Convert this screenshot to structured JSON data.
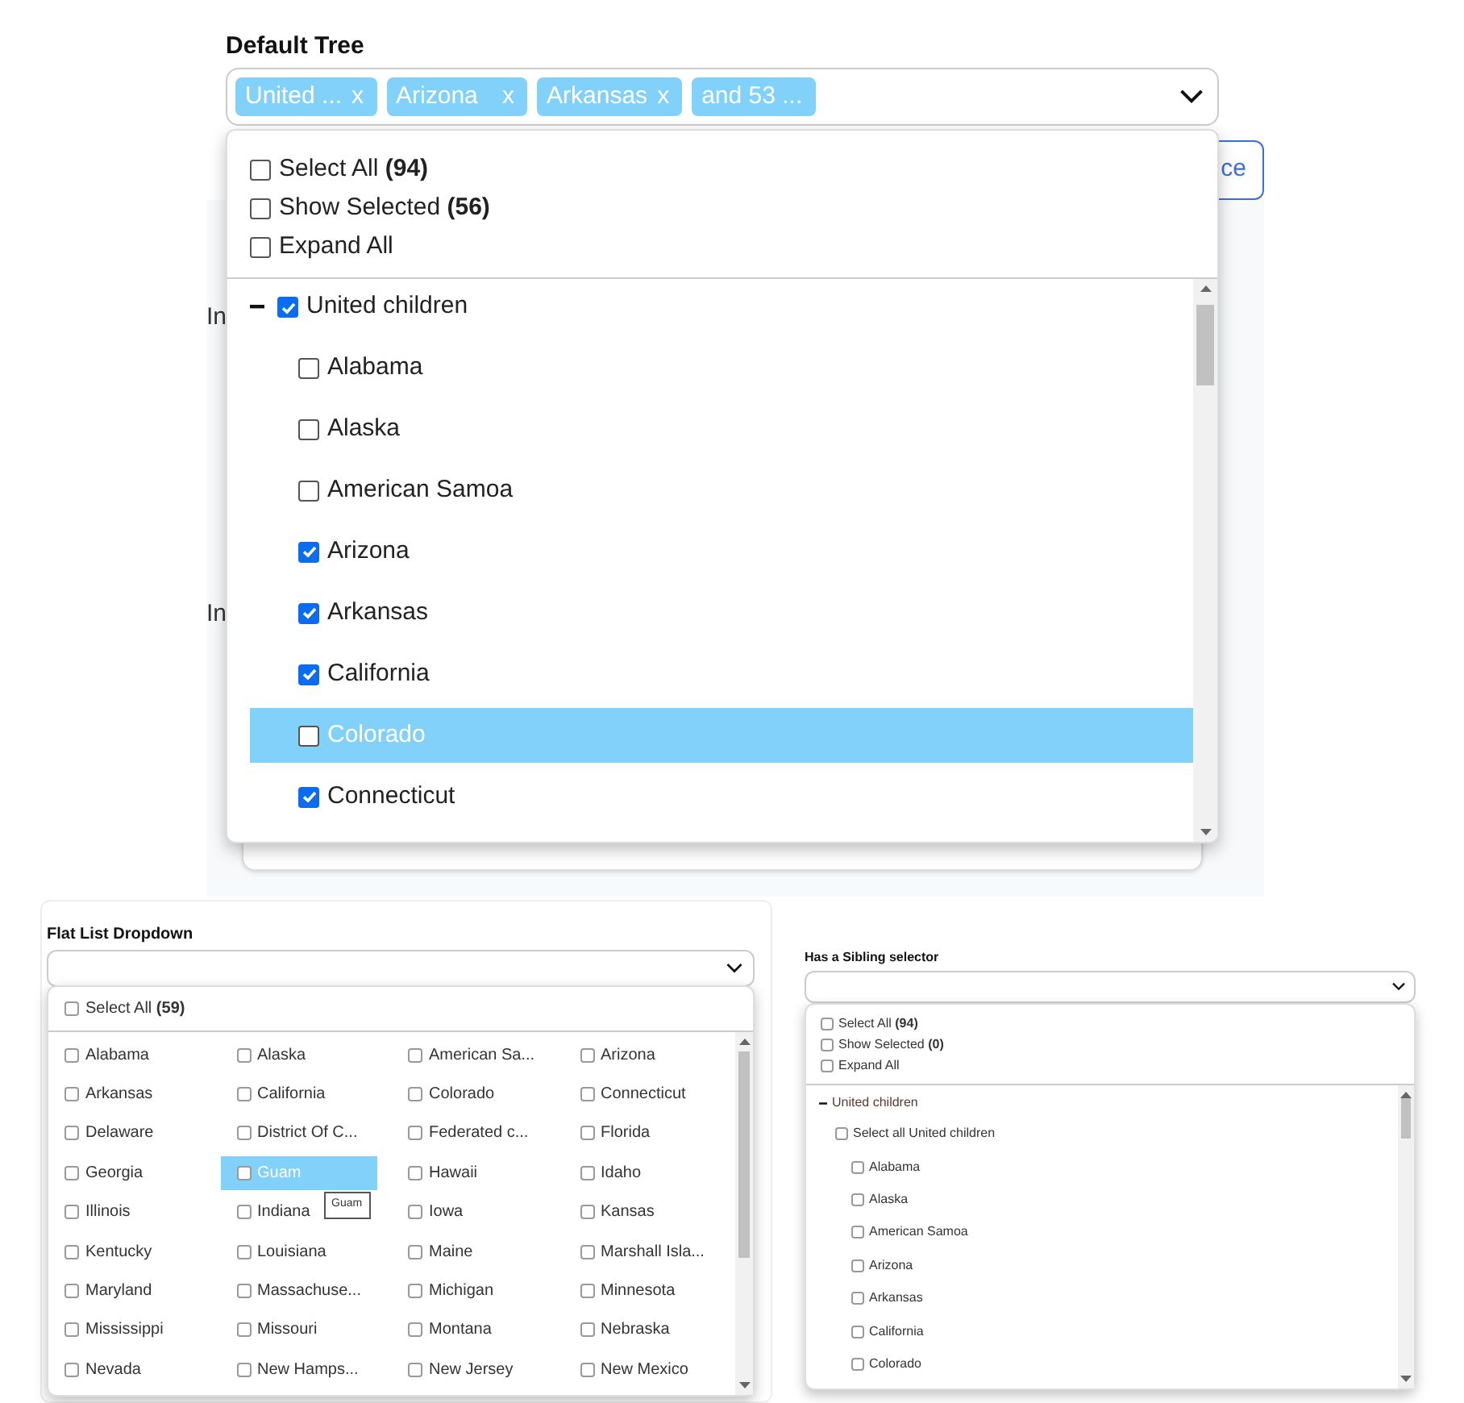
{
  "default_tree": {
    "label": "Default Tree",
    "tags": [
      {
        "text": "United ...",
        "remove": "x"
      },
      {
        "text": "Arizona",
        "remove": "x"
      },
      {
        "text": "Arkansas",
        "remove": "x"
      },
      {
        "text": "and 53 ..."
      }
    ],
    "options": [
      {
        "label": "Select All",
        "count": "(94)",
        "checked": false
      },
      {
        "label": "Show Selected",
        "count": "(56)",
        "checked": false
      },
      {
        "label": "Expand All",
        "checked": false
      }
    ],
    "tree": [
      {
        "label": "United children",
        "expanded": true,
        "checked": true,
        "children": [
          {
            "label": "Alabama",
            "checked": false,
            "highlighted": false
          },
          {
            "label": "Alaska",
            "checked": false,
            "highlighted": false
          },
          {
            "label": "American Samoa",
            "checked": false,
            "highlighted": false
          },
          {
            "label": "Arizona",
            "checked": true,
            "highlighted": false
          },
          {
            "label": "Arkansas",
            "checked": true,
            "highlighted": false
          },
          {
            "label": "California",
            "checked": true,
            "highlighted": false
          },
          {
            "label": "Colorado",
            "checked": false,
            "highlighted": true
          },
          {
            "label": "Connecticut",
            "checked": true,
            "highlighted": false
          }
        ]
      }
    ]
  },
  "background": {
    "labels": [
      "In",
      "In"
    ],
    "button": "ce"
  },
  "flat_list": {
    "label": "Flat List Dropdown",
    "select_all": {
      "label": "Select All",
      "count": "(59)",
      "checked": false
    },
    "tooltip": "Guam",
    "items": [
      {
        "label": "Alabama",
        "checked": false,
        "highlighted": false
      },
      {
        "label": "Alaska",
        "checked": false,
        "highlighted": false
      },
      {
        "label": "American Sa...",
        "checked": false,
        "highlighted": false
      },
      {
        "label": "Arizona",
        "checked": false,
        "highlighted": false
      },
      {
        "label": "Arkansas",
        "checked": false,
        "highlighted": false
      },
      {
        "label": "California",
        "checked": false,
        "highlighted": false
      },
      {
        "label": "Colorado",
        "checked": false,
        "highlighted": false
      },
      {
        "label": "Connecticut",
        "checked": false,
        "highlighted": false
      },
      {
        "label": "Delaware",
        "checked": false,
        "highlighted": false
      },
      {
        "label": "District Of C...",
        "checked": false,
        "highlighted": false
      },
      {
        "label": "Federated c...",
        "checked": false,
        "highlighted": false
      },
      {
        "label": "Florida",
        "checked": false,
        "highlighted": false
      },
      {
        "label": "Georgia",
        "checked": false,
        "highlighted": false
      },
      {
        "label": "Guam",
        "checked": false,
        "highlighted": true
      },
      {
        "label": "Hawaii",
        "checked": false,
        "highlighted": false
      },
      {
        "label": "Idaho",
        "checked": false,
        "highlighted": false
      },
      {
        "label": "Illinois",
        "checked": false,
        "highlighted": false
      },
      {
        "label": "Indiana",
        "checked": false,
        "highlighted": false
      },
      {
        "label": "Iowa",
        "checked": false,
        "highlighted": false
      },
      {
        "label": "Kansas",
        "checked": false,
        "highlighted": false
      },
      {
        "label": "Kentucky",
        "checked": false,
        "highlighted": false
      },
      {
        "label": "Louisiana",
        "checked": false,
        "highlighted": false
      },
      {
        "label": "Maine",
        "checked": false,
        "highlighted": false
      },
      {
        "label": "Marshall Isla...",
        "checked": false,
        "highlighted": false
      },
      {
        "label": "Maryland",
        "checked": false,
        "highlighted": false
      },
      {
        "label": "Massachuse...",
        "checked": false,
        "highlighted": false
      },
      {
        "label": "Michigan",
        "checked": false,
        "highlighted": false
      },
      {
        "label": "Minnesota",
        "checked": false,
        "highlighted": false
      },
      {
        "label": "Mississippi",
        "checked": false,
        "highlighted": false
      },
      {
        "label": "Missouri",
        "checked": false,
        "highlighted": false
      },
      {
        "label": "Montana",
        "checked": false,
        "highlighted": false
      },
      {
        "label": "Nebraska",
        "checked": false,
        "highlighted": false
      },
      {
        "label": "Nevada",
        "checked": false,
        "highlighted": false
      },
      {
        "label": "New Hamps...",
        "checked": false,
        "highlighted": false
      },
      {
        "label": "New Jersey",
        "checked": false,
        "highlighted": false
      },
      {
        "label": "New Mexico",
        "checked": false,
        "highlighted": false
      }
    ]
  },
  "sibling_selector": {
    "label": "Has a Sibling selector",
    "options": [
      {
        "label": "Select All",
        "count": "(94)",
        "checked": false
      },
      {
        "label": "Show Selected",
        "count": "(0)",
        "checked": false
      },
      {
        "label": "Expand All",
        "checked": false
      }
    ],
    "tree": [
      {
        "label": "United children",
        "expanded": true,
        "children": [
          {
            "kind": "select_all",
            "label": "Select all United children",
            "checked": false
          },
          {
            "kind": "option",
            "label": "Alabama",
            "checked": false
          },
          {
            "kind": "option",
            "label": "Alaska",
            "checked": false
          },
          {
            "kind": "option",
            "label": "American Samoa",
            "checked": false
          },
          {
            "kind": "option",
            "label": "Arizona",
            "checked": false
          },
          {
            "kind": "option",
            "label": "Arkansas",
            "checked": false
          },
          {
            "kind": "option",
            "label": "California",
            "checked": false
          },
          {
            "kind": "option",
            "label": "Colorado",
            "checked": false
          }
        ]
      }
    ]
  }
}
